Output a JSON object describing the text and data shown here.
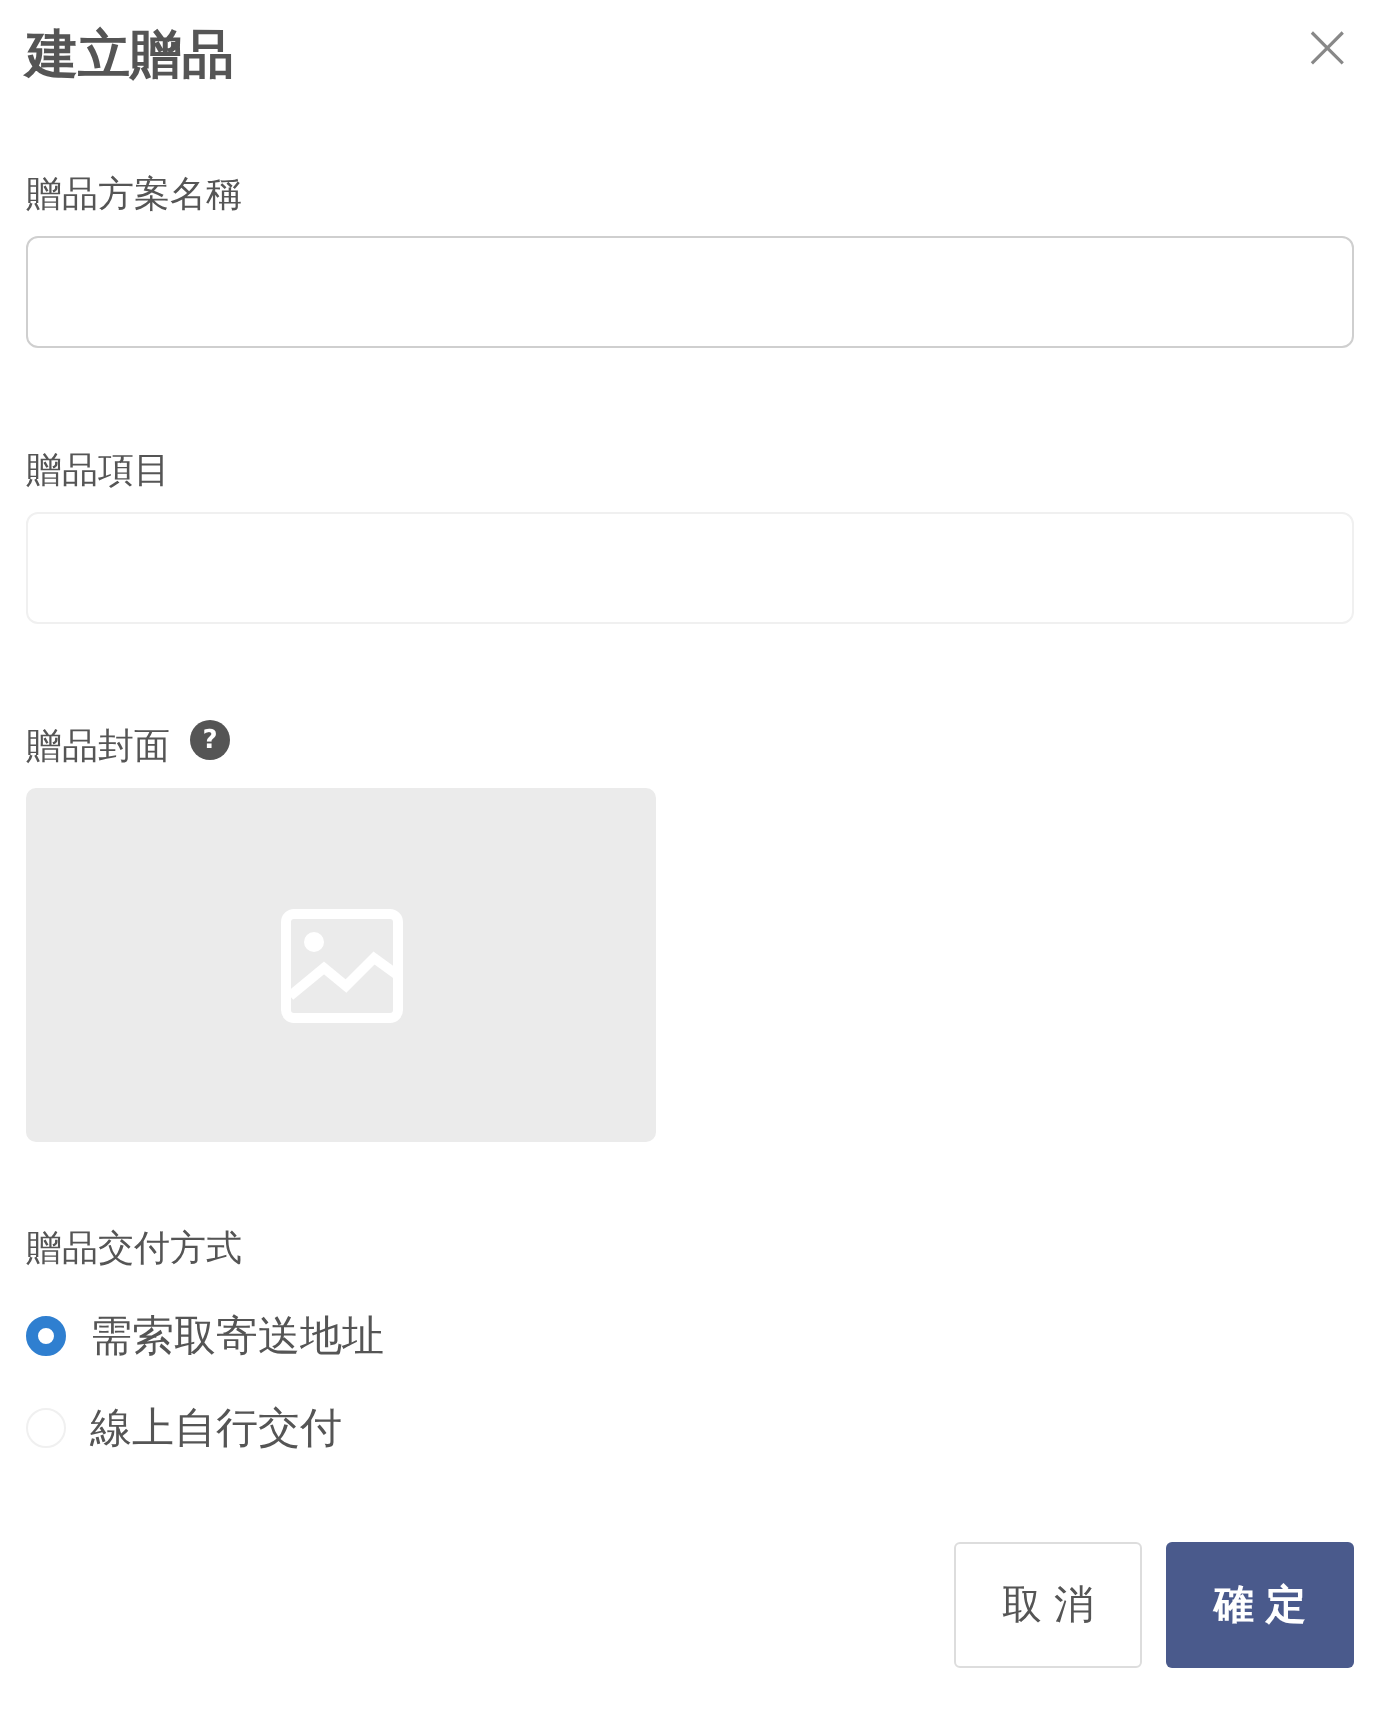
{
  "dialog": {
    "title": "建立贈品",
    "close": "×"
  },
  "fields": [
    {
      "label": "贈品方案名稱",
      "focused": true
    },
    {
      "label": "贈品項目",
      "focused": false
    }
  ],
  "cover": {
    "label": "贈品封面",
    "help": "?",
    "kind": "picture"
  },
  "delivery": {
    "label": "贈品交付方式",
    "options": [
      {
        "label": "需索取寄送地址",
        "selected": true
      },
      {
        "label": "線上自行交付",
        "selected": false
      }
    ]
  },
  "buttons": [
    {
      "label": "取消",
      "kind": "secondary"
    },
    {
      "label": "確定",
      "kind": "primary"
    }
  ]
}
